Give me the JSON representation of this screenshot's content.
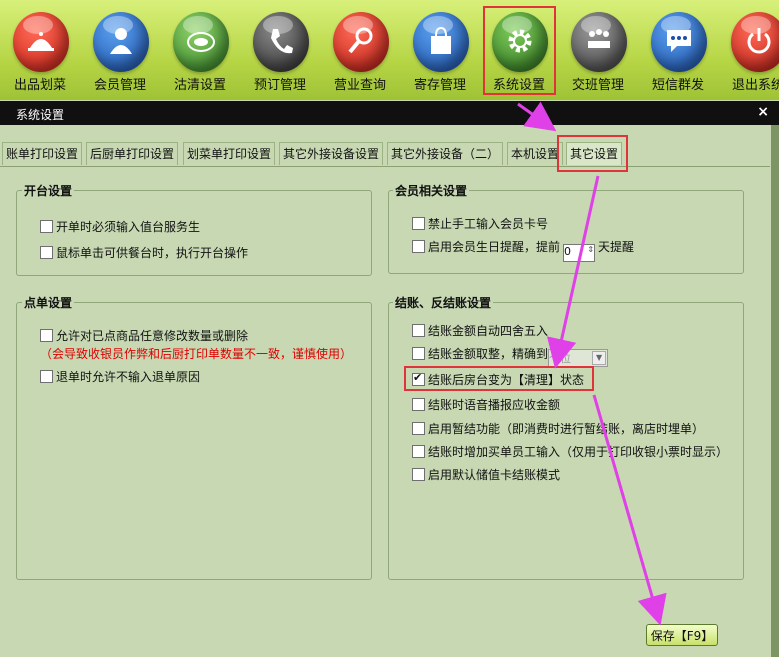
{
  "toolbar": {
    "items": [
      {
        "label": "出品划菜",
        "icon": "cloche-icon",
        "color": "#e23a2e"
      },
      {
        "label": "会员管理",
        "icon": "person-icon",
        "color": "#2a6cc7"
      },
      {
        "label": "沽清设置",
        "icon": "plate-icon",
        "color": "#4f9a37"
      },
      {
        "label": "预订管理",
        "icon": "phone-icon",
        "color": "#444444"
      },
      {
        "label": "营业查询",
        "icon": "magnifier-icon",
        "color": "#d3382e"
      },
      {
        "label": "寄存管理",
        "icon": "bag-icon",
        "color": "#2a6cc7"
      },
      {
        "label": "系统设置",
        "icon": "gear-icon",
        "color": "#3f8f2e"
      },
      {
        "label": "交班管理",
        "icon": "meeting-icon",
        "color": "#555555"
      },
      {
        "label": "短信群发",
        "icon": "sms-icon",
        "color": "#2a6cc7"
      },
      {
        "label": "退出系统",
        "icon": "power-icon",
        "color": "#d3382e"
      }
    ]
  },
  "window": {
    "title": "系统设置",
    "close": "×"
  },
  "tabs": [
    "账单打印设置",
    "后厨单打印设置",
    "划菜单打印设置",
    "其它外接设备设置",
    "其它外接设备（二）",
    "本机设置",
    "其它设置"
  ],
  "groups": {
    "open_table": {
      "title": "开台设置",
      "options": [
        {
          "label": "开单时必须输入值台服务生",
          "checked": false
        },
        {
          "label": "鼠标单击可供餐台时，执行开台操作",
          "checked": false
        }
      ]
    },
    "member": {
      "title": "会员相关设置",
      "opt1": "禁止手工输入会员卡号",
      "opt2_pre": "启用会员生日提醒，提前",
      "opt2_value": "0",
      "opt2_post": "天提醒"
    },
    "order": {
      "title": "点单设置",
      "opt1": "允许对已点商品任意修改数量或删除",
      "warning": "（会导致收银员作弊和后厨打印单数量不一致，谨慎使用）",
      "opt2": "退单时允许不输入退单原因"
    },
    "checkout": {
      "title": "结账、反结账设置",
      "options": [
        {
          "label": "结账金额自动四舍五入",
          "checked": false
        },
        {
          "label": "结账金额取整，精确到",
          "checked": false
        },
        {
          "label": "结账后房台变为【清理】状态",
          "checked": true
        },
        {
          "label": "结账时语音播报应收金额",
          "checked": false
        },
        {
          "label": "启用暂结功能（即消费时进行暂结账，离店时埋单）",
          "checked": false
        },
        {
          "label": "结账时增加买单员工输入（仅用于打印收银小票时显示）",
          "checked": false
        },
        {
          "label": "启用默认储值卡结账模式",
          "checked": false
        }
      ],
      "precision_value": "个位"
    }
  },
  "save_button": "保存【F9】",
  "colors": {
    "highlight": "#e0343a",
    "arrow": "#e040e8",
    "warning": "#e00000"
  }
}
